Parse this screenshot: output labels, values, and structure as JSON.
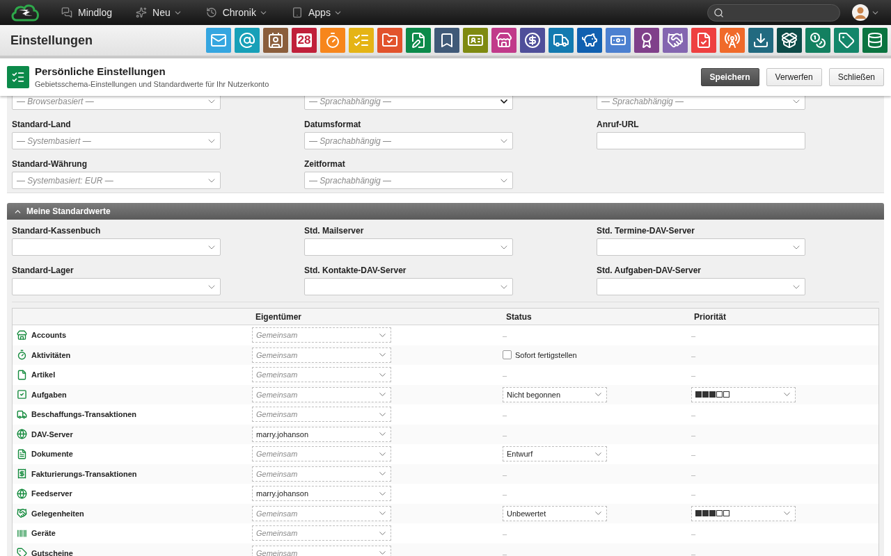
{
  "nav": {
    "items": [
      {
        "label": "Mindlog",
        "dropdown": false
      },
      {
        "label": "Neu",
        "dropdown": true
      },
      {
        "label": "Chronik",
        "dropdown": true
      },
      {
        "label": "Apps",
        "dropdown": true
      }
    ]
  },
  "toolbar": {
    "title": "Einstellungen",
    "apps": [
      {
        "color": "#35a6e0"
      },
      {
        "color": "#17a0b8"
      },
      {
        "color": "#8b5e3c"
      },
      {
        "color": "#c0203a",
        "label": "28"
      },
      {
        "color": "#f7861c"
      },
      {
        "color": "#e5b415"
      },
      {
        "color": "#e2532c"
      },
      {
        "color": "#0c8a4a"
      },
      {
        "color": "#405a78"
      },
      {
        "color": "#7f8a10"
      },
      {
        "color": "#c13a8a"
      },
      {
        "color": "#4f4f9a"
      },
      {
        "color": "#137ab0"
      },
      {
        "color": "#1160b0"
      },
      {
        "color": "#4c80d0"
      },
      {
        "color": "#80408a"
      },
      {
        "color": "#8466b0"
      },
      {
        "color": "#ee4040"
      },
      {
        "color": "#f06a2a"
      },
      {
        "color": "#226a80"
      },
      {
        "color": "#0d4b48"
      },
      {
        "color": "#138060"
      },
      {
        "color": "#14866a"
      },
      {
        "color": "#0b7440"
      }
    ]
  },
  "header": {
    "title": "Persönliche Einstellungen",
    "subtitle": "Gebietsschema-Einstellungen und Standardwerte für Ihr Nutzerkonto",
    "buttons": [
      {
        "label": "Speichern",
        "primary": true
      },
      {
        "label": "Verwerfen",
        "primary": false
      },
      {
        "label": "Schließen",
        "primary": false
      }
    ]
  },
  "locale_section": {
    "rows": [
      [
        {
          "kind": "select",
          "placeholder": "— Browserbasiert —",
          "focused": false
        },
        {
          "kind": "select",
          "placeholder": "— Sprachabhängig —",
          "focused": true
        },
        {
          "kind": "select",
          "placeholder": "— Sprachabhängig —",
          "focused": false
        }
      ],
      [
        {
          "kind": "select",
          "label": "Standard-Land",
          "placeholder": "— Systembasiert —",
          "focused": false
        },
        {
          "kind": "select",
          "label": "Datumsformat",
          "placeholder": "— Sprachabhängig —",
          "focused": false
        },
        {
          "kind": "text",
          "label": "Anruf-URL"
        }
      ],
      [
        {
          "kind": "select",
          "label": "Standard-Währung",
          "placeholder": "— Systembasiert: EUR —",
          "focused": false
        },
        {
          "kind": "select",
          "label": "Zeitformat",
          "placeholder": "— Sprachabhängig —",
          "focused": false
        }
      ]
    ]
  },
  "defaults_section": {
    "title": "Meine Standardwerte",
    "expanded": true,
    "rows": [
      [
        {
          "kind": "select",
          "label": "Standard-Kassenbuch",
          "focused": false
        },
        {
          "kind": "select",
          "label": "Std. Mailserver",
          "focused": false
        },
        {
          "kind": "select",
          "label": "Std. Termine-DAV-Server",
          "focused": false
        }
      ],
      [
        {
          "kind": "select",
          "label": "Standard-Lager",
          "focused": false
        },
        {
          "kind": "select",
          "label": "Std. Kontakte-DAV-Server",
          "focused": false
        },
        {
          "kind": "select",
          "label": "Std. Aufgaben-DAV-Server",
          "focused": false
        }
      ]
    ]
  },
  "table": {
    "columns": [
      "Eigentümer",
      "Status",
      "Priorität"
    ],
    "rows": [
      {
        "name": "Accounts",
        "owner": {
          "placeholder": "Gemeinsam"
        },
        "status": {
          "kind": "dash",
          "text": "–"
        },
        "priority": {
          "kind": "dash",
          "text": "–"
        }
      },
      {
        "name": "Aktivitäten",
        "owner": {
          "placeholder": "Gemeinsam"
        },
        "status": {
          "kind": "checkbox",
          "label": "Sofort fertigstellen",
          "checked": false
        },
        "priority": {
          "kind": "dash",
          "text": "–"
        }
      },
      {
        "name": "Artikel",
        "owner": {
          "placeholder": "Gemeinsam"
        },
        "status": {
          "kind": "dash",
          "text": "–"
        },
        "priority": {
          "kind": "dash",
          "text": "–"
        }
      },
      {
        "name": "Aufgaben",
        "owner": {
          "placeholder": "Gemeinsam"
        },
        "status": {
          "kind": "select",
          "value": "Nicht begonnen"
        },
        "priority": {
          "kind": "select",
          "stars": 3
        }
      },
      {
        "name": "Beschaffungs-Transaktionen",
        "owner": {
          "placeholder": "Gemeinsam"
        },
        "status": {
          "kind": "dash",
          "text": "–"
        },
        "priority": {
          "kind": "dash",
          "text": "–"
        }
      },
      {
        "name": "DAV-Server",
        "owner": {
          "value": "marry.johanson"
        },
        "status": {
          "kind": "dash",
          "text": "–"
        },
        "priority": {
          "kind": "dash",
          "text": "–"
        }
      },
      {
        "name": "Dokumente",
        "owner": {
          "placeholder": "Gemeinsam"
        },
        "status": {
          "kind": "select",
          "value": "Entwurf"
        },
        "priority": {
          "kind": "dash",
          "text": "–"
        }
      },
      {
        "name": "Fakturierungs-Transaktionen",
        "owner": {
          "placeholder": "Gemeinsam"
        },
        "status": {
          "kind": "dash",
          "text": "–"
        },
        "priority": {
          "kind": "dash",
          "text": "–"
        }
      },
      {
        "name": "Feedserver",
        "owner": {
          "value": "marry.johanson"
        },
        "status": {
          "kind": "dash",
          "text": "–"
        },
        "priority": {
          "kind": "dash",
          "text": "–"
        }
      },
      {
        "name": "Gelegenheiten",
        "owner": {
          "placeholder": "Gemeinsam"
        },
        "status": {
          "kind": "select",
          "value": "Unbewertet"
        },
        "priority": {
          "kind": "select",
          "stars": 3
        }
      },
      {
        "name": "Geräte",
        "owner": {
          "placeholder": "Gemeinsam"
        },
        "status": {
          "kind": "dash",
          "text": "–"
        },
        "priority": {
          "kind": "dash",
          "text": "–"
        }
      },
      {
        "name": "Gutscheine",
        "owner": {
          "placeholder": "Gemeinsam"
        },
        "status": {
          "kind": "dash",
          "text": "–"
        },
        "priority": {
          "kind": "dash",
          "text": "–"
        }
      }
    ]
  }
}
